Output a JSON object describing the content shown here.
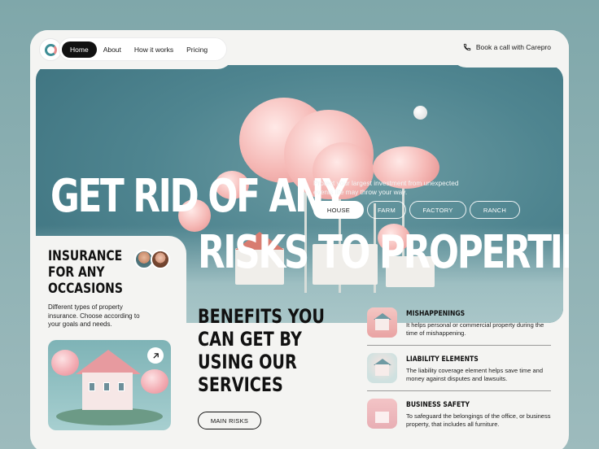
{
  "nav": {
    "items": [
      "Home",
      "About",
      "How it works",
      "Pricing"
    ],
    "active": "Home",
    "book_call": "Book a call with Carepro"
  },
  "hero": {
    "headline_line1": "GET RID OF ANY",
    "headline_line2": "RISKS TO PROPERTIES",
    "subtitle": "Protect your largest investment from unexpected events life may throw your way.",
    "tabs": [
      "HOUSE",
      "FARM",
      "FACTORY",
      "RANCH"
    ],
    "active_tab": "HOUSE"
  },
  "insurance": {
    "title": "INSURANCE FOR ANY OCCASIONS",
    "text": "Different types of property insurance. Choose according to your goals and needs."
  },
  "benefits": {
    "title": "BENEFITS YOU CAN GET BY USING OUR SERVICES",
    "button": "MAIN RISKS"
  },
  "features": [
    {
      "title": "MISHAPPENINGS",
      "text": "It helps personal or commercial property during the time of mishappening."
    },
    {
      "title": "LIABILITY ELEMENTS",
      "text": "The liability coverage element helps save time and money against disputes and lawsuits."
    },
    {
      "title": "BUSINESS SAFETY",
      "text": "To safeguard the belongings of the office, or business property, that includes all furniture."
    }
  ],
  "colors": {
    "background": "#8fb1b3",
    "card": "#f4f4f2",
    "hero": "#4f8590",
    "accent_pink": "#f5b8b5",
    "dark": "#111111"
  },
  "icons": [
    "logo-icon",
    "phone-icon",
    "arrow-up-right-icon"
  ]
}
